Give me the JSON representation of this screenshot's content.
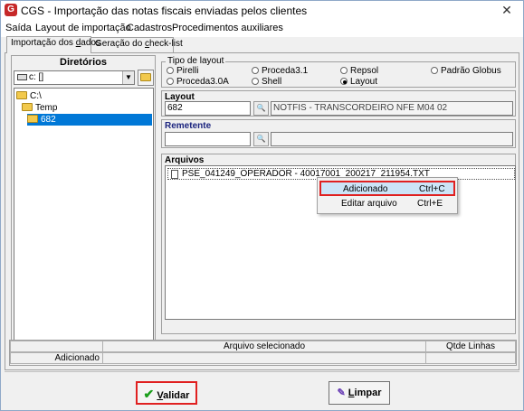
{
  "window": {
    "title": "CGS - Importação das notas fiscais enviadas pelos clientes",
    "close": "✕",
    "icon_letter": "G"
  },
  "menu": [
    "Saída",
    "Layout de importação",
    "Cadastros",
    "Procedimentos auxiliares"
  ],
  "tabs": [
    {
      "pre": "Importação dos ",
      "u": "d",
      "post": "ados"
    },
    {
      "pre": "Geração do ",
      "u": "c",
      "post": "heck-list"
    }
  ],
  "directories": {
    "header": "Diretórios",
    "drive": "c: []",
    "tree": [
      "C:\\",
      "Temp",
      "682"
    ],
    "selected": "682"
  },
  "layout_type": {
    "legend": "Tipo de layout",
    "options": [
      "Pirelli",
      "Proceda3.1",
      "Repsol",
      "Padrão Globus",
      "Proceda3.0A",
      "Shell",
      "Layout"
    ],
    "selected": "Layout"
  },
  "layout": {
    "label": "Layout",
    "code": "682",
    "description": "NOTFIS - TRANSCORDEIRO NFE M04 02"
  },
  "remetente": {
    "label": "Remetente",
    "code": "",
    "description": ""
  },
  "arquivos": {
    "label": "Arquivos",
    "files": [
      "PSE_041249_OPERADOR - 40017001_200217_211954.TXT"
    ]
  },
  "context_menu": [
    {
      "label": "Adicionado",
      "shortcut": "Ctrl+C"
    },
    {
      "label": "Editar arquivo",
      "shortcut": "Ctrl+E"
    }
  ],
  "status": {
    "col_arquivo": "Arquivo selecionado",
    "col_qtde": "Qtde Linhas",
    "row_label": "Adicionado"
  },
  "buttons": {
    "validar": {
      "u": "V",
      "rest": "alidar"
    },
    "limpar": {
      "u": "L",
      "rest": "impar"
    }
  },
  "colors": {
    "selection": "#0078d7",
    "highlight_outline": "#e02020",
    "remetente_label": "#1a237e"
  }
}
